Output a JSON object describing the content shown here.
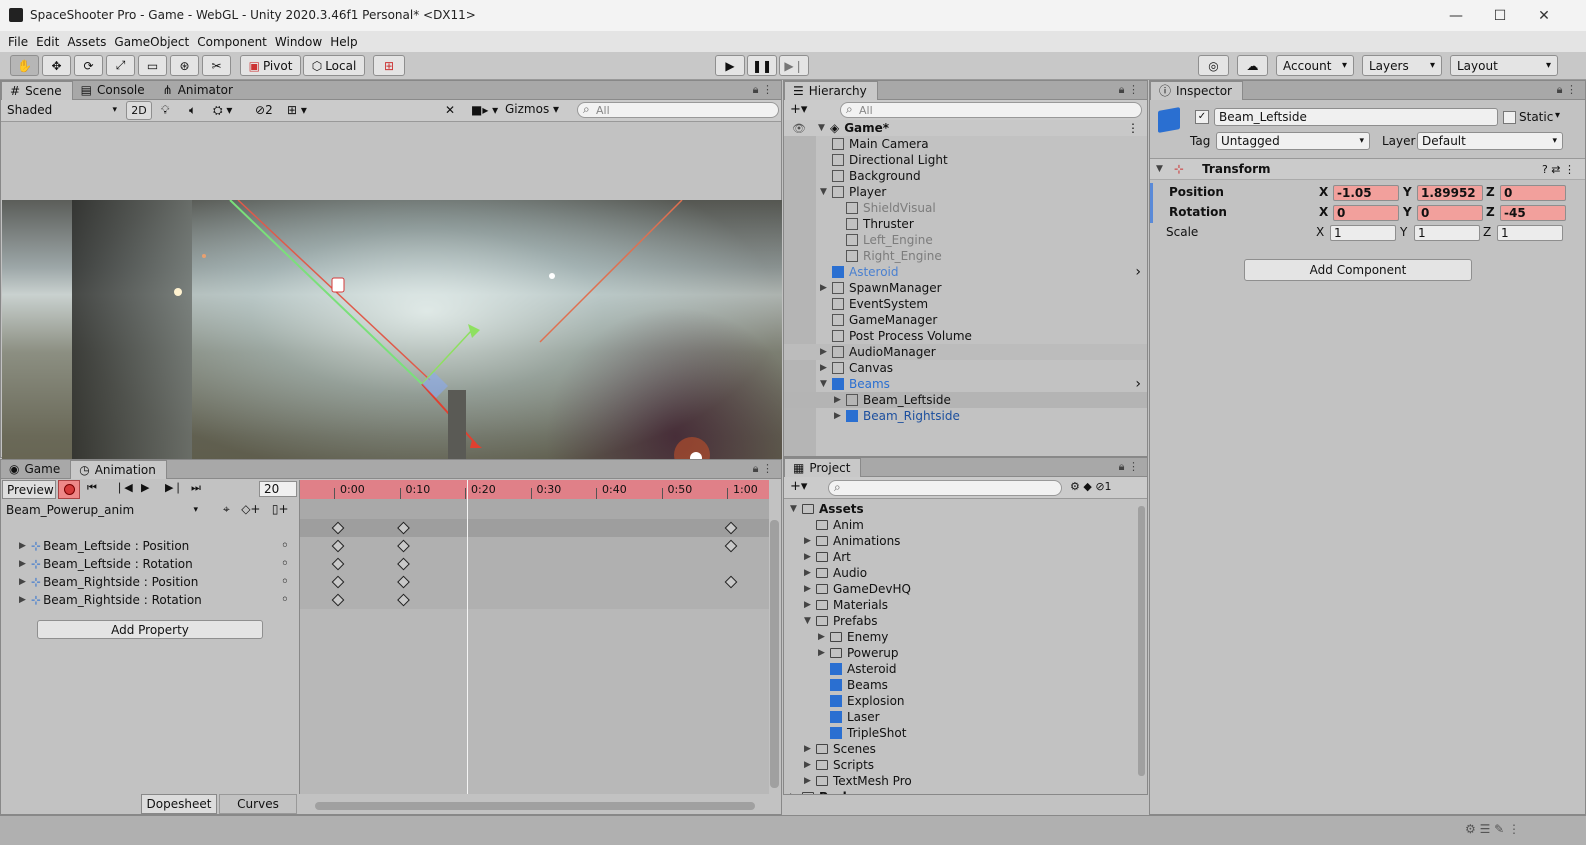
{
  "window": {
    "title": "SpaceShooter Pro - Game - WebGL - Unity 2020.3.46f1 Personal* <DX11>",
    "min": "—",
    "max": "☐",
    "close": "✕"
  },
  "menu": [
    "File",
    "Edit",
    "Assets",
    "GameObject",
    "Component",
    "Window",
    "Help"
  ],
  "toolbar": {
    "pivot": "Pivot",
    "local": "Local",
    "account": "Account",
    "layers": "Layers",
    "layout": "Layout"
  },
  "scene": {
    "tabs": [
      "Scene",
      "Console",
      "Animator"
    ],
    "shading": "Shaded",
    "mode2d": "2D",
    "hidden_count": "2",
    "gizmos": "Gizmos",
    "search_placeholder": "All"
  },
  "hierarchy": {
    "tab": "Hierarchy",
    "search_placeholder": "All",
    "root": "Game*",
    "items": [
      {
        "label": "Main Camera",
        "indent": 1,
        "exp": "",
        "style": "normal"
      },
      {
        "label": "Directional Light",
        "indent": 1,
        "exp": "",
        "style": "normal"
      },
      {
        "label": "Background",
        "indent": 1,
        "exp": "",
        "style": "normal"
      },
      {
        "label": "Player",
        "indent": 1,
        "exp": "▼",
        "style": "normal"
      },
      {
        "label": "ShieldVisual",
        "indent": 2,
        "exp": "",
        "style": "disabled"
      },
      {
        "label": "Thruster",
        "indent": 2,
        "exp": "",
        "style": "normal"
      },
      {
        "label": "Left_Engine",
        "indent": 2,
        "exp": "",
        "style": "disabled"
      },
      {
        "label": "Right_Engine",
        "indent": 2,
        "exp": "",
        "style": "disabled"
      },
      {
        "label": "Asteroid",
        "indent": 1,
        "exp": "",
        "style": "prefab-light"
      },
      {
        "label": "SpawnManager",
        "indent": 1,
        "exp": "▶",
        "style": "normal"
      },
      {
        "label": "EventSystem",
        "indent": 1,
        "exp": "",
        "style": "normal"
      },
      {
        "label": "GameManager",
        "indent": 1,
        "exp": "",
        "style": "normal"
      },
      {
        "label": "Post Process Volume",
        "indent": 1,
        "exp": "",
        "style": "normal"
      },
      {
        "label": "AudioManager",
        "indent": 1,
        "exp": "▶",
        "style": "hover"
      },
      {
        "label": "Canvas",
        "indent": 1,
        "exp": "▶",
        "style": "normal"
      },
      {
        "label": "Beams",
        "indent": 1,
        "exp": "▼",
        "style": "prefab"
      },
      {
        "label": "Beam_Leftside",
        "indent": 2,
        "exp": "▶",
        "style": "selected"
      },
      {
        "label": "Beam_Rightside",
        "indent": 2,
        "exp": "▶",
        "style": "prefab-dark"
      }
    ]
  },
  "inspector": {
    "tab": "Inspector",
    "object_name": "Beam_Leftside",
    "static_label": "Static",
    "tag_label": "Tag",
    "tag_value": "Untagged",
    "layer_label": "Layer",
    "layer_value": "Default",
    "component": "Transform",
    "rows": [
      {
        "label": "Position",
        "x": "-1.05",
        "y": "1.89952",
        "z": "0",
        "animated": true
      },
      {
        "label": "Rotation",
        "x": "0",
        "y": "0",
        "z": "-45",
        "animated": true
      },
      {
        "label": "Scale",
        "x": "1",
        "y": "1",
        "z": "1",
        "animated": false
      }
    ],
    "axis_x": "X",
    "axis_y": "Y",
    "axis_z": "Z",
    "add_component": "Add Component"
  },
  "animation": {
    "tabs": [
      "Game",
      "Animation"
    ],
    "preview": "Preview",
    "frame": "20",
    "clip": "Beam_Powerup_anim",
    "time_labels": [
      "0:00",
      "0:10",
      "0:20",
      "0:30",
      "0:40",
      "0:50",
      "1:00"
    ],
    "properties": [
      "Beam_Leftside : Position",
      "Beam_Leftside : Rotation",
      "Beam_Rightside : Position",
      "Beam_Rightside : Rotation"
    ],
    "add_property": "Add Property",
    "dopesheet": "Dopesheet",
    "curves": "Curves"
  },
  "project": {
    "tab": "Project",
    "hidden_count": "1",
    "items": [
      {
        "label": "Assets",
        "indent": 0,
        "exp": "▼",
        "kind": "folder-open",
        "bold": true
      },
      {
        "label": "Anim",
        "indent": 1,
        "exp": "",
        "kind": "folder",
        "bold": false
      },
      {
        "label": "Animations",
        "indent": 1,
        "exp": "▶",
        "kind": "folder",
        "bold": false
      },
      {
        "label": "Art",
        "indent": 1,
        "exp": "▶",
        "kind": "folder",
        "bold": false
      },
      {
        "label": "Audio",
        "indent": 1,
        "exp": "▶",
        "kind": "folder",
        "bold": false
      },
      {
        "label": "GameDevHQ",
        "indent": 1,
        "exp": "▶",
        "kind": "folder",
        "bold": false
      },
      {
        "label": "Materials",
        "indent": 1,
        "exp": "▶",
        "kind": "folder",
        "bold": false
      },
      {
        "label": "Prefabs",
        "indent": 1,
        "exp": "▼",
        "kind": "folder-open",
        "bold": false
      },
      {
        "label": "Enemy",
        "indent": 2,
        "exp": "▶",
        "kind": "folder",
        "bold": false
      },
      {
        "label": "Powerup",
        "indent": 2,
        "exp": "▶",
        "kind": "folder",
        "bold": false
      },
      {
        "label": "Asteroid",
        "indent": 2,
        "exp": "",
        "kind": "prefab",
        "bold": false
      },
      {
        "label": "Beams",
        "indent": 2,
        "exp": "",
        "kind": "prefab",
        "bold": false
      },
      {
        "label": "Explosion",
        "indent": 2,
        "exp": "",
        "kind": "prefab",
        "bold": false
      },
      {
        "label": "Laser",
        "indent": 2,
        "exp": "",
        "kind": "prefab",
        "bold": false
      },
      {
        "label": "TripleShot",
        "indent": 2,
        "exp": "",
        "kind": "prefab",
        "bold": false
      },
      {
        "label": "Scenes",
        "indent": 1,
        "exp": "▶",
        "kind": "folder",
        "bold": false
      },
      {
        "label": "Scripts",
        "indent": 1,
        "exp": "▶",
        "kind": "folder",
        "bold": false
      },
      {
        "label": "TextMesh Pro",
        "indent": 1,
        "exp": "▶",
        "kind": "folder",
        "bold": false
      },
      {
        "label": "Packages",
        "indent": 0,
        "exp": "▶",
        "kind": "folder",
        "bold": true
      }
    ]
  },
  "colors": {
    "prefab_blue": "#2a6fd1",
    "record_red": "#d43a3a",
    "anim_field": "#f2a09c",
    "selection": "#b4b4b4"
  }
}
